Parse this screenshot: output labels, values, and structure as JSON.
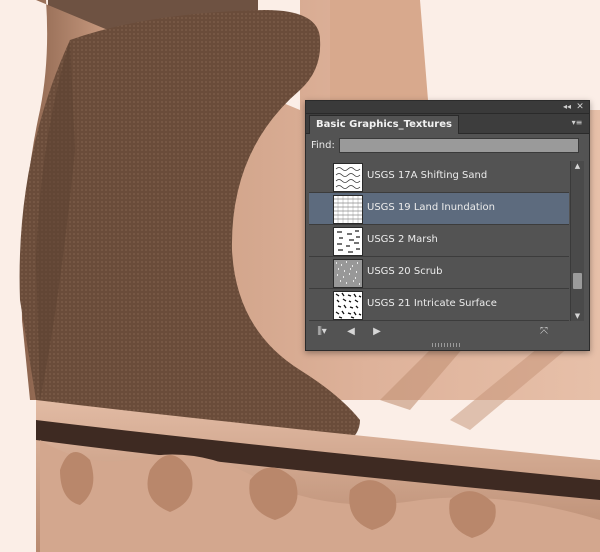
{
  "panel": {
    "tab_title": "Basic Graphics_Textures",
    "find_label": "Find:",
    "find_value": "",
    "collapse_icon": "double-left-arrow-icon",
    "close_icon": "close-icon",
    "menu_icon": "panel-menu-icon",
    "items": [
      {
        "label": "USGS 17A Shifting Sand",
        "selected": false,
        "pattern": "waves"
      },
      {
        "label": "USGS 19 Land Inundation",
        "selected": true,
        "pattern": "grid"
      },
      {
        "label": "USGS 2 Marsh",
        "selected": false,
        "pattern": "dashes"
      },
      {
        "label": "USGS 20 Scrub",
        "selected": false,
        "pattern": "noise"
      },
      {
        "label": "USGS 21 Intricate Surface",
        "selected": false,
        "pattern": "speckle"
      }
    ],
    "bottom": {
      "library_icon": "swatch-library-menu-icon",
      "prev_icon": "previous-library-icon",
      "next_icon": "next-library-icon",
      "break_link_icon": "break-link-icon"
    }
  },
  "colors": {
    "panel_bg": "#535353",
    "selected_row": "#5d6b7e",
    "boot_dark": "#7b5a45",
    "boot_light": "#d9aa8f"
  }
}
